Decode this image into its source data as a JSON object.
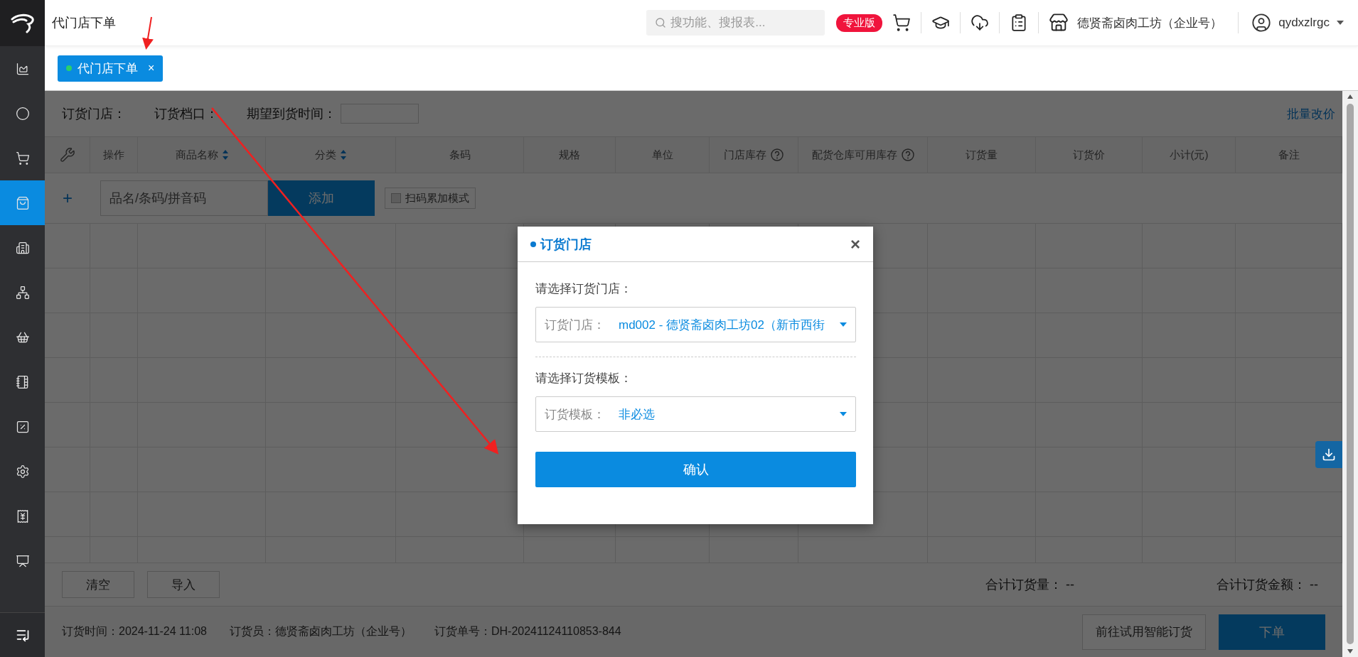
{
  "app_title": "代门店下单",
  "search": {
    "placeholder": "搜功能、搜报表..."
  },
  "edition_badge": "专业版",
  "store_name": "德贤斋卤肉工坊（企业号）",
  "username": "qydxzlrgc",
  "sidebar": {
    "items": [
      {
        "kind": "report",
        "selected": false
      },
      {
        "kind": "circle",
        "selected": false
      },
      {
        "kind": "cart",
        "selected": false
      },
      {
        "kind": "bag",
        "selected": true
      },
      {
        "kind": "building",
        "selected": false
      },
      {
        "kind": "network",
        "selected": false
      },
      {
        "kind": "basket",
        "selected": false
      },
      {
        "kind": "notebook",
        "selected": false
      },
      {
        "kind": "percent",
        "selected": false
      },
      {
        "kind": "settings",
        "selected": false
      },
      {
        "kind": "receipt",
        "selected": false
      },
      {
        "kind": "presentation",
        "selected": false
      }
    ]
  },
  "tabs": [
    {
      "label": "代门店下单",
      "selected": true,
      "close": "×"
    }
  ],
  "filters": [
    {
      "label": "订货门店：",
      "kind": "text"
    },
    {
      "label": "订货档口：",
      "kind": "text"
    },
    {
      "label": "期望到货时间：",
      "kind": "date"
    }
  ],
  "batch_link": "批量改价",
  "table": {
    "columns": [
      {
        "label": "操作",
        "sortable": false,
        "help": false
      },
      {
        "label": "商品名称",
        "sortable": true,
        "help": false
      },
      {
        "label": "分类",
        "sortable": true,
        "help": false
      },
      {
        "label": "条码",
        "sortable": false,
        "help": false
      },
      {
        "label": "规格",
        "sortable": false,
        "help": false
      },
      {
        "label": "单位",
        "sortable": false,
        "help": false
      },
      {
        "label": "门店库存",
        "sortable": false,
        "help": true
      },
      {
        "label": "配货仓库可用库存",
        "sortable": false,
        "help": true
      },
      {
        "label": "订货量",
        "sortable": false,
        "help": false
      },
      {
        "label": "订货价",
        "sortable": false,
        "help": false
      },
      {
        "label": "小计(元)",
        "sortable": false,
        "help": false
      },
      {
        "label": "备注",
        "sortable": false,
        "help": false
      }
    ]
  },
  "add_row": {
    "plus": "+",
    "placeholder": "品名/条码/拼音码",
    "button": "添加",
    "scan_mode": {
      "label": "扫码累加模式",
      "checked": false
    }
  },
  "actions": [
    "清空",
    "导入"
  ],
  "totals": [
    {
      "label": "合计订货量：",
      "value": "--"
    },
    {
      "label": "合计订货金额：",
      "value": "--"
    }
  ],
  "footer": {
    "info": [
      "订货时间：2024-11-24 11:08",
      "订货员：德贤斋卤肉工坊（企业号）",
      "订货单号：DH-20241124110853-844"
    ],
    "secondary_button": "前往试用智能订货",
    "primary_button": "下单"
  },
  "dialog": {
    "title": "订货门店",
    "close": "×",
    "sections": [
      {
        "prompt": "请选择订货门店：",
        "field_label": "订货门店：",
        "value": "md002 - 德贤斋卤肉工坊02（新市西街"
      },
      {
        "prompt": "请选择订货模板：",
        "field_label": "订货模板：",
        "value": "非必选"
      }
    ],
    "confirm": "确认"
  }
}
